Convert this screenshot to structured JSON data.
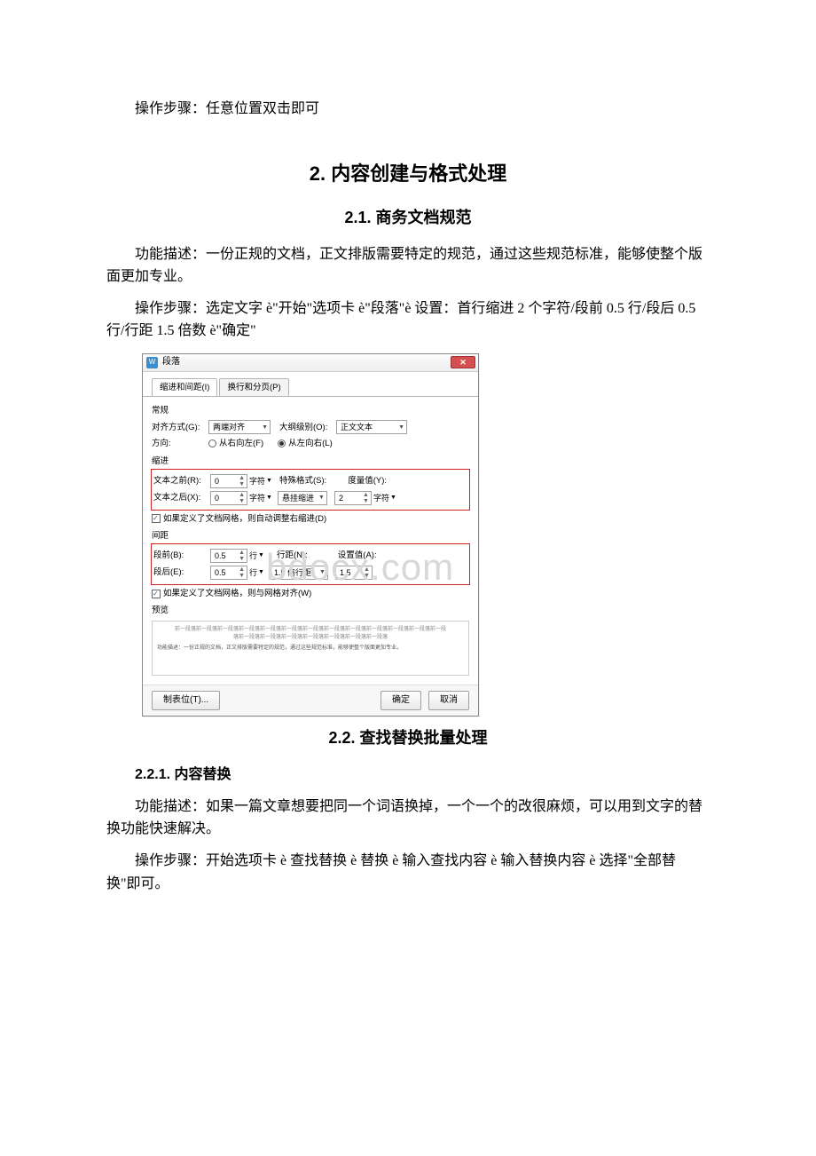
{
  "body": {
    "intro_step": "操作步骤：任意位置双击即可",
    "h2": "2. 内容创建与格式处理",
    "h3_1": "2.1. 商务文档规范",
    "p1": "功能描述：一份正规的文档，正文排版需要特定的规范，通过这些规范标准，能够使整个版面更加专业。",
    "p2": "操作步骤：选定文字 è\"开始\"选项卡 è\"段落\"è 设置：首行缩进 2 个字符/段前 0.5 行/段后 0.5 行/行距 1.5 倍数 è\"确定\"",
    "h3_2": "2.2. 查找替换批量处理",
    "h4": "2.2.1. 内容替换",
    "p3": "功能描述：如果一篇文章想要把同一个词语换掉，一个一个的改很麻烦，可以用到文字的替换功能快速解决。",
    "p4": "操作步骤：开始选项卡 è 查找替换 è 替换 è 输入查找内容 è 输入替换内容 è 选择\"全部替换\"即可。"
  },
  "watermark": "bdocx.com",
  "dialog": {
    "title": "段落",
    "close": "✕",
    "tabs": {
      "active": "缩进和间距(I)",
      "inactive": "换行和分页(P)"
    },
    "general_label": "常规",
    "align_label": "对齐方式(G):",
    "align_value": "两端对齐",
    "outline_label": "大纲级别(O):",
    "outline_value": "正文文本",
    "dir_label": "方向:",
    "dir_rtl": "从右向左(F)",
    "dir_ltr": "从左向右(L)",
    "indent_label": "缩进",
    "before_text": "文本之前(R):",
    "after_text": "文本之后(X):",
    "before_val": "0",
    "after_val": "0",
    "char_unit": "字符",
    "special_label": "特殊格式(S):",
    "special_value": "悬挂缩进",
    "metric_label": "度量值(Y):",
    "metric_value": "2",
    "auto_indent": "如果定义了文档网格，则自动调整右缩进(D)",
    "spacing_label": "间距",
    "space_before": "段前(B):",
    "space_after": "段后(E):",
    "sb_val": "0.5",
    "sa_val": "0.5",
    "line_unit": "行",
    "linespace_label": "行距(N):",
    "linespace_value": "1.5 倍行距",
    "setval_label": "设置值(A):",
    "setval_value": "1.5",
    "grid_align": "如果定义了文档网格，则与网格对齐(W)",
    "preview_label": "预览",
    "preview_lines": "前一段落前一段落前一段落前一段落前一段落前一段落前一段落前一段落前一段落前一段落前一段落前一段落前一段落前一段落前一段落前一段落前一段落前一段落前一段落前一段落",
    "preview_body": "功能描述：一份正规的文档，正文排版需要特定的规范，通过这些规范标准，能够使整个版面更加专业。",
    "tabstop": "制表位(T)...",
    "ok": "确定",
    "cancel": "取消"
  }
}
